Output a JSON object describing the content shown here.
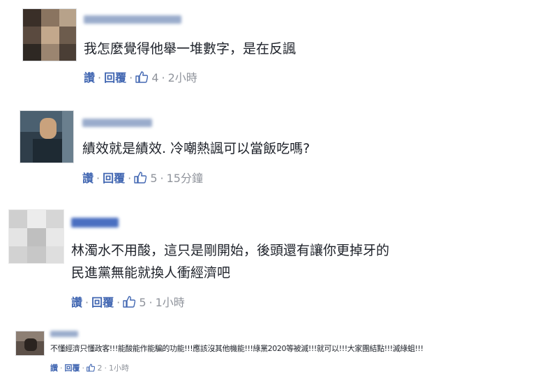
{
  "comments": [
    {
      "text": "我怎麼覺得他舉一堆數字，是在反諷",
      "actions": {
        "like": "讚",
        "reply": "回覆",
        "likes": "4",
        "time": "2小時"
      }
    },
    {
      "text": "績效就是績效. 冷嘲熱諷可以當飯吃嗎?",
      "actions": {
        "like": "讚",
        "reply": "回覆",
        "likes": "5",
        "time": "15分鐘"
      }
    },
    {
      "text_lines": [
        "林濁水不用酸，這只是剛開始，後頭還有讓你更掉牙的",
        "民進黨無能就換人衝經濟吧"
      ],
      "actions": {
        "like": "讚",
        "reply": "回覆",
        "likes": "5",
        "time": "1小時"
      }
    },
    {
      "text": "不懂經濟只懂政客!!!能酸能作能騙的功能!!!應該沒其他機能!!!綠黨2020等被滅!!!就可以!!!大家團結點!!!滅綠蛆!!!",
      "actions": {
        "like": "讚",
        "reply": "回覆",
        "likes": "2",
        "time": "1小時"
      }
    }
  ],
  "colors": {
    "link": "#4267b2",
    "meta": "#90949c",
    "text": "#1d2129"
  },
  "icons": {
    "like": "thumbs-up-icon"
  }
}
